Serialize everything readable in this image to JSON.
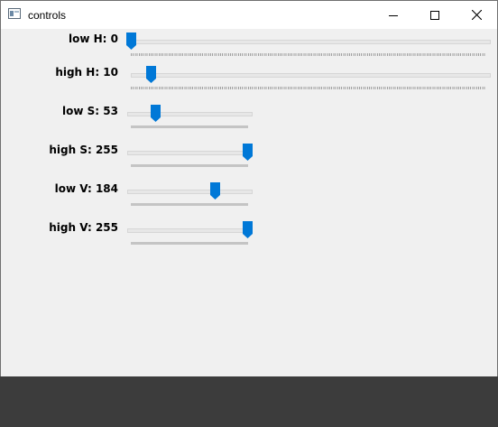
{
  "window": {
    "title": "controls",
    "minimize_icon": "minimize-icon",
    "maximize_icon": "maximize-icon",
    "close_icon": "close-icon"
  },
  "trackbars": [
    {
      "label": "low H: 0",
      "value": 0,
      "max": 179,
      "wide": true
    },
    {
      "label": "high H: 10",
      "value": 10,
      "max": 179,
      "wide": true
    },
    {
      "label": "low S: 53",
      "value": 53,
      "max": 255,
      "wide": false
    },
    {
      "label": "high S: 255",
      "value": 255,
      "max": 255,
      "wide": false
    },
    {
      "label": "low V: 184",
      "value": 184,
      "max": 255,
      "wide": false
    },
    {
      "label": "high V: 255",
      "value": 255,
      "max": 255,
      "wide": false
    }
  ],
  "colors": {
    "accent": "#0078d7",
    "window_bg": "#f0f0f0",
    "desktop": "#3c3c3c"
  }
}
